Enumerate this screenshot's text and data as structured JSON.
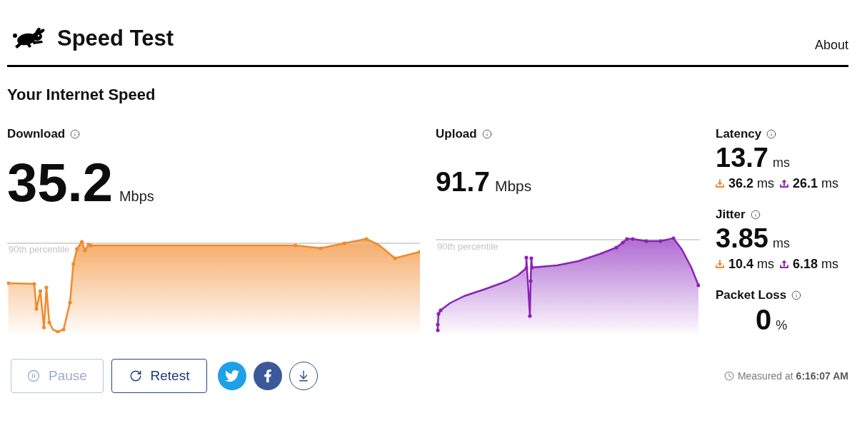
{
  "header": {
    "title": "Speed Test",
    "about_link": "About"
  },
  "heading": "Your Internet Speed",
  "speeds": [
    {
      "kind": "download",
      "label": "Download",
      "value": "35.2",
      "unit": "Mbps",
      "percentile_label": "90th percentile"
    },
    {
      "kind": "upload",
      "label": "Upload",
      "value": "91.7",
      "unit": "Mbps",
      "percentile_label": "90th percentile"
    }
  ],
  "stats": [
    {
      "kind": "split",
      "label": "Latency",
      "value": "13.7",
      "unit": "ms",
      "breakdown": [
        {
          "kind": "download",
          "text": "**36.2** ms"
        },
        {
          "kind": "upload",
          "text": "**26.1** ms"
        }
      ]
    },
    {
      "kind": "split",
      "label": "Jitter",
      "value": "3.85",
      "unit": "ms",
      "breakdown": [
        {
          "kind": "download",
          "text": "**10.4** ms"
        },
        {
          "kind": "upload",
          "text": "**6.18** ms"
        }
      ]
    },
    {
      "kind": "single",
      "label": "Packet Loss",
      "value": "0",
      "unit": "%"
    }
  ],
  "actions": [
    {
      "kind": "pause",
      "label": "Pause",
      "disabled": true
    },
    {
      "kind": "retest",
      "label": "Retest",
      "disabled": false
    }
  ],
  "measured": "Measured at **6:16:07 AM**"
}
